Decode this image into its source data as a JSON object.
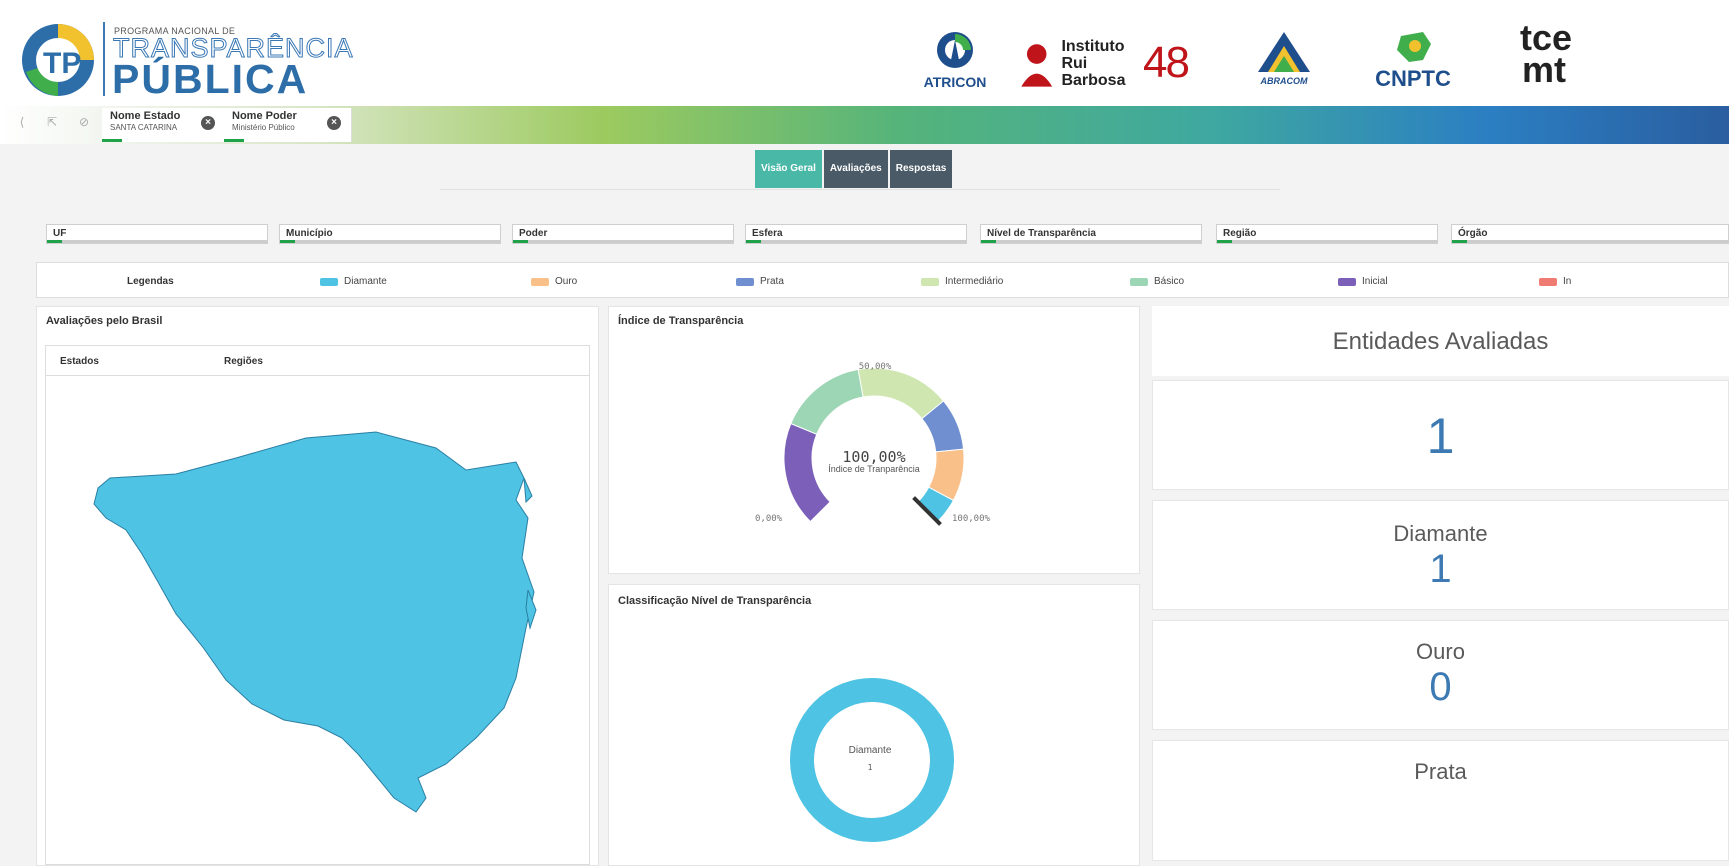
{
  "brand": {
    "line1": "PROGRAMA NACIONAL DE",
    "line2": "TRANSPARÊNCIA",
    "line3": "PÚBLICA",
    "accent": "#2d6ea8"
  },
  "partners": {
    "atricon": "ATRICON",
    "irb_line1": "Instituto",
    "irb_line2": "Rui Barbosa",
    "irb_number": "48",
    "abracom": "ABRACOM",
    "cnptc": "CNPTC",
    "tce_top": "tce",
    "tce_bottom": "mt"
  },
  "selections": [
    {
      "label": "Nome Estado",
      "value": "SANTA CATARINA",
      "icon": "close-icon"
    },
    {
      "label": "Nome Poder",
      "value": "Ministério Público",
      "icon": "close-icon"
    }
  ],
  "tabs": [
    {
      "label": "Visão Geral",
      "active": true
    },
    {
      "label": "Avaliações"
    },
    {
      "label": "Respostas"
    }
  ],
  "filters": [
    "UF",
    "Município",
    "Poder",
    "Esfera",
    "Nível de Transparência",
    "Região",
    "Órgão"
  ],
  "legend": {
    "title": "Legendas",
    "items": [
      {
        "label": "Diamante",
        "color": "#4fc3e3"
      },
      {
        "label": "Ouro",
        "color": "#f9c08a"
      },
      {
        "label": "Prata",
        "color": "#6f8fd0"
      },
      {
        "label": "Intermediário",
        "color": "#cfe6b0"
      },
      {
        "label": "Básico",
        "color": "#9dd6b4"
      },
      {
        "label": "Inicial",
        "color": "#7b5fb8"
      },
      {
        "label": "In",
        "color": "#ef7b72"
      }
    ]
  },
  "map_panel": {
    "title": "Avaliações pelo Brasil",
    "tab_states": "Estados",
    "tab_regions": "Regiões",
    "fill": "#4fc3e3"
  },
  "gauge_panel": {
    "title": "Índice de Transparência",
    "center_value": "100,00%",
    "center_label": "Índice de Tranparência",
    "min_label": "0,00%",
    "mid_label": "50,00%",
    "max_label": "100,00%"
  },
  "class_panel": {
    "title": "Classificação Nível de Transparência",
    "center_label": "Diamante",
    "center_value": "1"
  },
  "kpis": {
    "heading": "Entidades Avaliadas",
    "total": "1",
    "diamante_label": "Diamante",
    "diamante_value": "1",
    "ouro_label": "Ouro",
    "ouro_value": "0",
    "prata_label": "Prata"
  },
  "chart_data": [
    {
      "type": "pie",
      "title": "Índice de Transparência",
      "categories": [
        "Inicial",
        "Básico",
        "Intermediário",
        "Prata",
        "Ouro",
        "Diamante"
      ],
      "values": [
        20,
        17,
        18,
        10,
        10,
        5
      ],
      "ylim": [
        0,
        100
      ],
      "value": 100
    },
    {
      "type": "pie",
      "title": "Classificação Nível de Transparência",
      "categories": [
        "Diamante"
      ],
      "values": [
        1
      ]
    }
  ]
}
